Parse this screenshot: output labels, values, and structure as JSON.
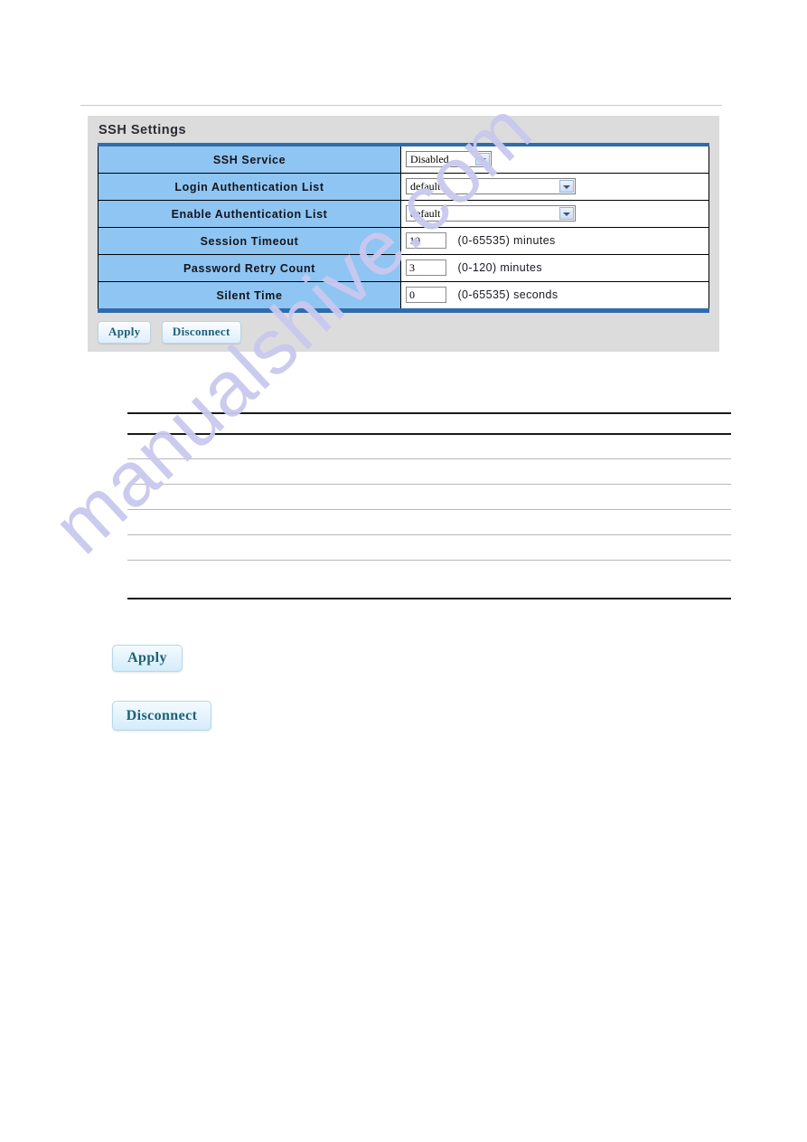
{
  "panel": {
    "title": "SSH Settings",
    "rows": [
      {
        "label": "SSH Service",
        "control": "select",
        "width": "narrow",
        "value": "Disabled",
        "hint": ""
      },
      {
        "label": "Login Authentication List",
        "control": "select",
        "width": "wide",
        "value": "default",
        "hint": ""
      },
      {
        "label": "Enable Authentication List",
        "control": "select",
        "width": "wide",
        "value": "default",
        "hint": ""
      },
      {
        "label": "Session Timeout",
        "control": "text",
        "value": "10",
        "hint": "(0-65535) minutes"
      },
      {
        "label": "Password Retry Count",
        "control": "text",
        "value": "3",
        "hint": "(0-120) minutes"
      },
      {
        "label": "Silent Time",
        "control": "text",
        "value": "0",
        "hint": "(0-65535) seconds"
      }
    ],
    "buttons": {
      "apply": "Apply",
      "disconnect": "Disconnect"
    }
  },
  "document": {
    "apply_button": "Apply",
    "disconnect_button": "Disconnect"
  },
  "watermark": {
    "text": "manualshive.com"
  },
  "colors": {
    "label_blue": "#8fc5f2",
    "table_border_blue": "#2f6cab",
    "panel_gray": "#dcdcdc",
    "button_text": "#1d6079",
    "watermark": "#c9c9ef"
  }
}
